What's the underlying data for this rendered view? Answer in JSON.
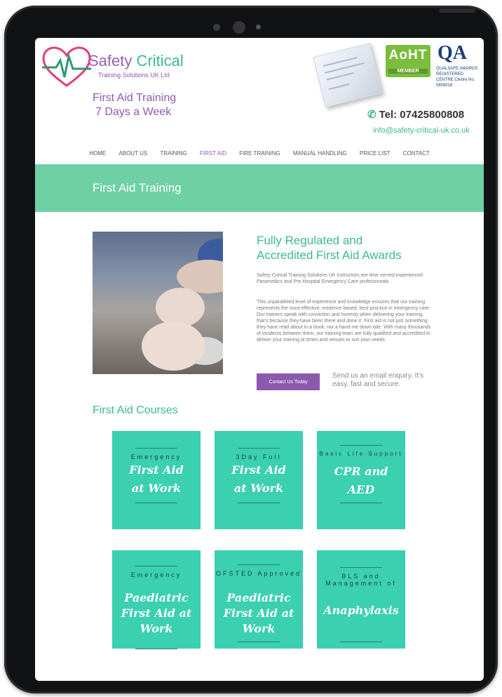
{
  "header": {
    "logo_word1": "Safety",
    "logo_word2": "Critical",
    "logo_sub": "Training Solutions UK Ltd",
    "tagline_line1": "First Aid Training",
    "tagline_line2": "7 Days a Week",
    "aoht_title": "AoHT",
    "aoht_member": "MEMBER",
    "qa_logo": "QA",
    "qa_text": "QUALSAFE AWARDS REGISTERED CENTRE Centre No. 0809018",
    "phone": "Tel: 07425800808",
    "email": "info@safety-critical-uk.co.uk"
  },
  "nav": {
    "items": [
      "HOME",
      "ABOUT US",
      "TRAINING",
      "FIRST AID",
      "FIRE TRAINING",
      "MANUAL HANDLING",
      "PRICE LIST",
      "CONTACT"
    ],
    "active": "FIRST AID"
  },
  "banner": {
    "title": "First Aid Training"
  },
  "main": {
    "heading_line1": "Fully Regulated and",
    "heading_line2": "Accredited First Aid Awards",
    "para1": "Safety Critical Training Solutions UK instructors are time served experienced Paramedics and Pre Hospital Emergency Care professionals.",
    "para2": "This unparalleled level of experience and knowledge ensures that our training represents the most effective, evidence based, best practice in emergency care. Our trainers speak with conviction and honesty when delivering your training, that's because they have been there and done it. First aid is not just something they have read about in a book, nor a hand me down tale. With many thousands of incidents between them, our training team are fully qualified and accredited to deliver your training at times and venues to suit your needs.",
    "contact_button": "Contact Us Today",
    "enquiry_text": "Send us an email enquiry. It's easy, fast and secure."
  },
  "courses": {
    "title": "First Aid Courses",
    "cards": [
      {
        "top": "Emergency",
        "script1": "First Aid",
        "script2": "at Work",
        "script3": ""
      },
      {
        "top": "3Day Full",
        "script1": "First Aid",
        "script2": "at Work",
        "script3": ""
      },
      {
        "top": "Basic Life Support",
        "script1": "CPR and",
        "script2": "AED",
        "script3": ""
      },
      {
        "top": "Emergency",
        "script1": "Paediatric",
        "script2": "First Aid at",
        "script3": "Work"
      },
      {
        "top": "OFSTED Approved",
        "script1": "Paediatric",
        "script2": "First Aid at",
        "script3": "Work"
      },
      {
        "top": "BLS and Management of",
        "script1": "Anaphylaxis",
        "script2": "",
        "script3": ""
      }
    ]
  },
  "colors": {
    "green": "#3dba8e",
    "purple": "#8e5ab3",
    "banner": "#6fd0a6",
    "card": "#3ad0b0"
  }
}
